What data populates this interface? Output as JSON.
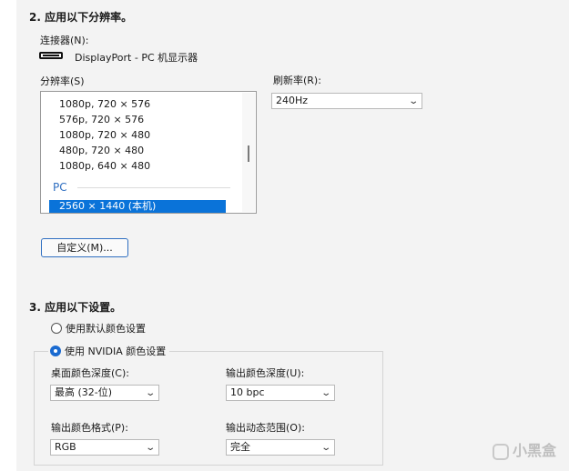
{
  "section2": {
    "heading": "2. 应用以下分辨率。",
    "connector_label": "连接器(N):",
    "connector_value": "DisplayPort - PC 机显示器",
    "resolution_label": "分辨率(S)",
    "refresh_label": "刷新率(R):",
    "refresh_value": "240Hz",
    "resolutions": [
      "1080p, 720 × 576",
      "576p, 720 × 576",
      "1080p, 720 × 480",
      "480p, 720 × 480",
      "1080p, 640 × 480"
    ],
    "group_pc": "PC",
    "selected_resolution": "2560 × 1440 (本机)",
    "customize_button": "自定义(M)..."
  },
  "section3": {
    "heading": "3. 应用以下设置。",
    "radio_default": "使用默认颜色设置",
    "radio_nvidia": "使用 NVIDIA 颜色设置",
    "selected_radio": "nvidia",
    "desktop_depth_label": "桌面颜色深度(C):",
    "desktop_depth_value": "最高 (32-位)",
    "output_depth_label": "输出颜色深度(U):",
    "output_depth_value": "10 bpc",
    "output_format_label": "输出颜色格式(P):",
    "output_format_value": "RGB",
    "output_range_label": "输出动态范围(O):",
    "output_range_value": "完全"
  },
  "watermark": "小黑盒",
  "colors": {
    "accent": "#0a73d9",
    "panel": "#f3f3f3",
    "group_label": "#2f6fc1"
  }
}
